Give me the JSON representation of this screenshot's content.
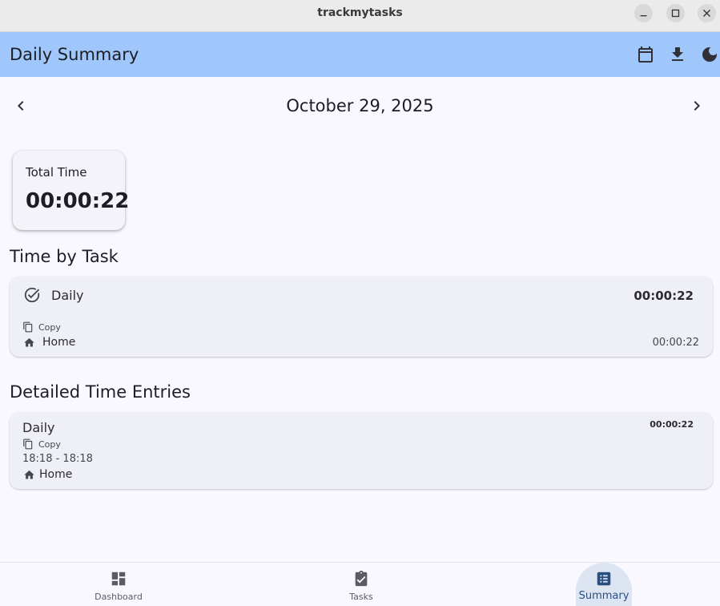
{
  "window": {
    "title": "trackmytasks",
    "controls": [
      "minimize-icon",
      "maximize-icon",
      "close-icon"
    ]
  },
  "appbar": {
    "title": "Daily Summary",
    "actions": [
      "calendar-icon",
      "download-icon",
      "dark-mode-icon"
    ]
  },
  "date_nav": {
    "date": "October 29, 2025"
  },
  "total_card": {
    "label": "Total Time",
    "value": "00:00:22"
  },
  "time_by_task": {
    "heading": "Time by Task",
    "tasks": [
      {
        "name": "Daily",
        "total": "00:00:22",
        "copy_label": "Copy",
        "category": "Home",
        "category_time": "00:00:22"
      }
    ]
  },
  "detailed_entries": {
    "heading": "Detailed Time Entries",
    "entries": [
      {
        "name": "Daily",
        "duration": "00:00:22",
        "copy_label": "Copy",
        "range": "18:18 - 18:18",
        "category": "Home"
      }
    ]
  },
  "bottom_nav": {
    "items": [
      {
        "label": "Dashboard",
        "icon": "dashboard-icon"
      },
      {
        "label": "Tasks",
        "icon": "task-icon"
      },
      {
        "label": "Summary",
        "icon": "summary-icon",
        "selected": true
      }
    ]
  },
  "colors": {
    "appbar_bg": "#9fc7fb",
    "page_bg": "#f8f8fe",
    "card_bg": "#efeff6",
    "nav_selected": "#2c4f82"
  }
}
